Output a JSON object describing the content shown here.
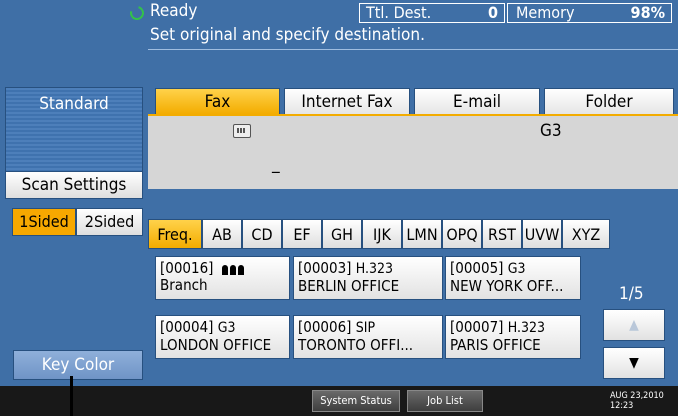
{
  "header": {
    "status": "Ready",
    "message": "Set original and specify destination.",
    "total_dest_label": "Ttl. Dest.",
    "total_dest_value": "0",
    "memory_label": "Memory",
    "memory_value": "98%"
  },
  "left_panel": {
    "standard_label": "Standard",
    "scan_settings_label": "Scan Settings",
    "sided_1": "1Sided",
    "sided_2": "2Sided",
    "key_color_label": "Key Color"
  },
  "tabs": [
    {
      "label": "Fax"
    },
    {
      "label": "Internet Fax"
    },
    {
      "label": "E-mail"
    },
    {
      "label": "Folder"
    }
  ],
  "destination_area": {
    "mode": "G3",
    "cursor": "_"
  },
  "index_tabs": [
    {
      "label": "Freq."
    },
    {
      "label": "AB"
    },
    {
      "label": "CD"
    },
    {
      "label": "EF"
    },
    {
      "label": "GH"
    },
    {
      "label": "IJK"
    },
    {
      "label": "LMN"
    },
    {
      "label": "OPQ"
    },
    {
      "label": "RST"
    },
    {
      "label": "UVW"
    },
    {
      "label": "XYZ"
    }
  ],
  "destinations": [
    {
      "id": "[00016]",
      "type": "",
      "name": "Branch",
      "group": true
    },
    {
      "id": "[00003]",
      "type": "H.323",
      "name": "BERLIN OFFICE"
    },
    {
      "id": "[00005]",
      "type": "G3",
      "name": "NEW YORK OFF..."
    },
    {
      "id": "[00004]",
      "type": "G3",
      "name": "LONDON OFFICE"
    },
    {
      "id": "[00006]",
      "type": "SIP",
      "name": "TORONTO OFFI..."
    },
    {
      "id": "[00007]",
      "type": "H.323",
      "name": "PARIS OFFICE"
    }
  ],
  "pagination": {
    "page": "1/5",
    "up_icon": "up-arrow-icon",
    "down_icon": "down-arrow-icon"
  },
  "statusbar": {
    "system_status": "System Status",
    "job_list": "Job List",
    "date": "AUG  23,2010",
    "time": "12:23"
  }
}
